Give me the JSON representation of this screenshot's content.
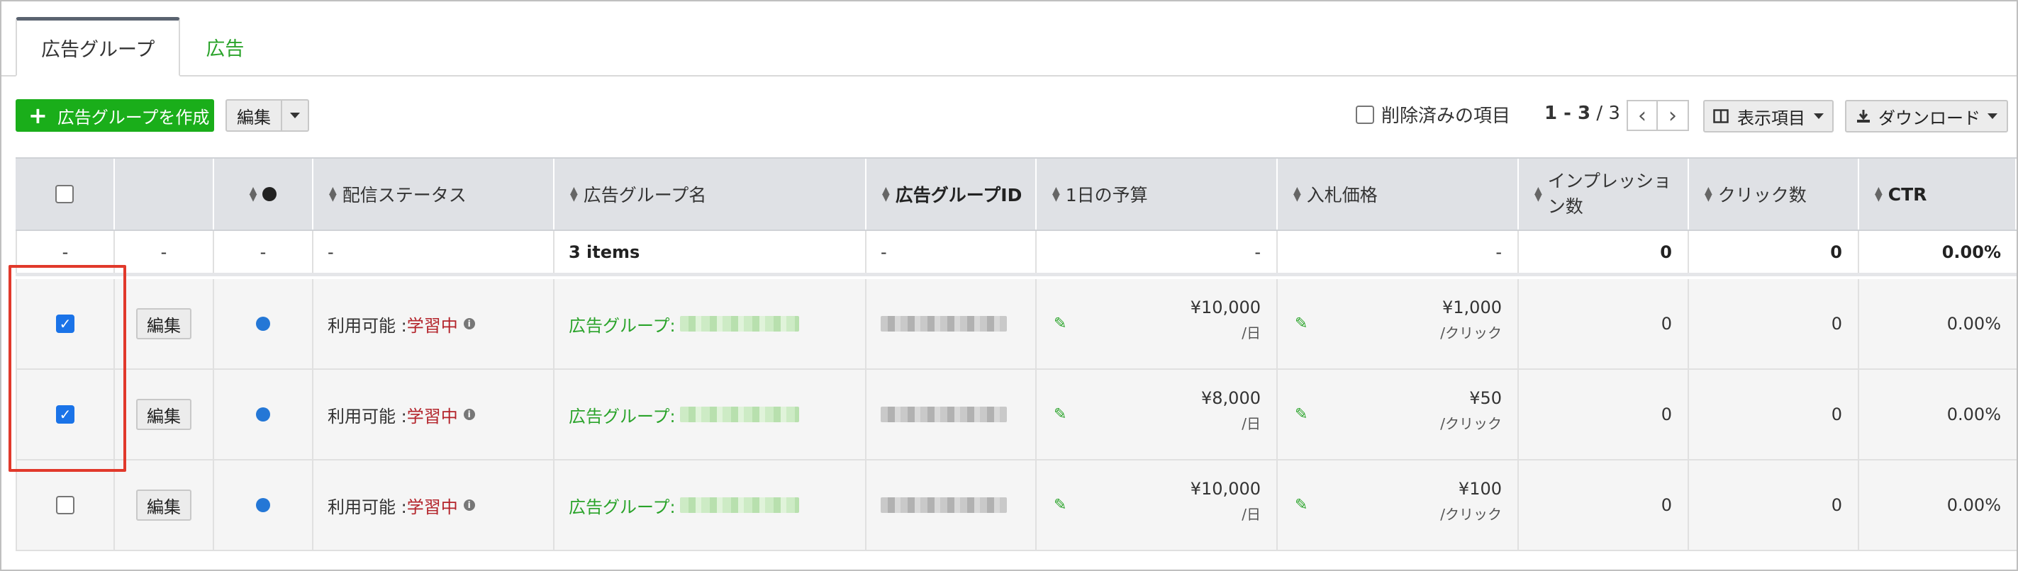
{
  "tabs": [
    {
      "label": "広告グループ",
      "active": true
    },
    {
      "label": "広告",
      "active": false
    }
  ],
  "toolbar": {
    "create_label": "広告グループを作成",
    "edit_label": "編集",
    "deleted_label": "削除済みの項目",
    "pager_range": "1 - 3",
    "pager_sep": " / ",
    "pager_total": "3",
    "columns_label": "表示項目",
    "download_label": "ダウンロード"
  },
  "table": {
    "headers": {
      "status": "配信ステータス",
      "name": "広告グループ名",
      "id": "広告グループID",
      "budget": "1日の予算",
      "bid": "入札価格",
      "impressions": "インプレッション数",
      "clicks": "クリック数",
      "ctr": "CTR"
    },
    "summary": {
      "c0": "-",
      "c1": "-",
      "c2": "-",
      "status": "-",
      "name": "3 items",
      "id": "-",
      "budget": "-",
      "bid": "-",
      "impressions": "0",
      "clicks": "0",
      "ctr": "0.00%"
    },
    "rows": [
      {
        "checked": true,
        "edit": "編集",
        "status_prefix": "利用可能 : ",
        "status_state": "学習中",
        "name_prefix": "広告グループ:",
        "budget": "¥10,000",
        "budget_unit": "/日",
        "bid": "¥1,000",
        "bid_unit": "/クリック",
        "impressions": "0",
        "clicks": "0",
        "ctr": "0.00%"
      },
      {
        "checked": true,
        "edit": "編集",
        "status_prefix": "利用可能 : ",
        "status_state": "学習中",
        "name_prefix": "広告グループ:",
        "budget": "¥8,000",
        "budget_unit": "/日",
        "bid": "¥50",
        "bid_unit": "/クリック",
        "impressions": "0",
        "clicks": "0",
        "ctr": "0.00%"
      },
      {
        "checked": false,
        "edit": "編集",
        "status_prefix": "利用可能 : ",
        "status_state": "学習中",
        "name_prefix": "広告グループ:",
        "budget": "¥10,000",
        "budget_unit": "/日",
        "bid": "¥100",
        "bid_unit": "/クリック",
        "impressions": "0",
        "clicks": "0",
        "ctr": "0.00%"
      }
    ]
  },
  "colors": {
    "accent_green": "#1aae1a",
    "link_green": "#2aa32a",
    "learning_red": "#b3232a",
    "status_dot_blue": "#2477d6",
    "highlight_red": "#e1392b"
  }
}
